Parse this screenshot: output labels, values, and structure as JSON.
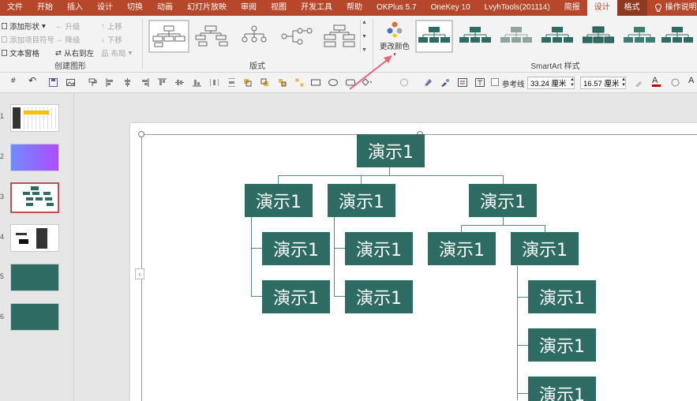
{
  "menu": {
    "tabs": [
      "文件",
      "开始",
      "插入",
      "设计",
      "切换",
      "动画",
      "幻灯片放映",
      "审阅",
      "视图",
      "开发工具",
      "帮助",
      "OKPlus 5.7",
      "OneKey 10",
      "LvyhTools(201114)",
      "简报",
      "设计",
      "格式"
    ],
    "tell_me": "操作说明搜"
  },
  "ribbon": {
    "create": {
      "add_shape": "添加形状",
      "add_bullet": "添加项目符号",
      "text_pane": "文本窗格",
      "promote": "升级",
      "demote": "降级",
      "rtl": "从右到左",
      "move_up": "上移",
      "move_down": "下移",
      "layout": "布局",
      "label": "创建图形"
    },
    "layouts_label": "版式",
    "change_colors": "更改颜色",
    "styles_label": "SmartArt 样式"
  },
  "toolbar": {
    "reference_line": "参考线",
    "width": "33.24 厘米",
    "height": "16.57 厘米"
  },
  "slides": [
    "1",
    "2",
    "3",
    "4",
    "5",
    "6"
  ],
  "diagram": {
    "node_label": "演示1",
    "color": "#2e6b63"
  },
  "colors": {
    "accent": "#b7472a",
    "node": "#2e6b63",
    "arrow": "#e8647a"
  }
}
